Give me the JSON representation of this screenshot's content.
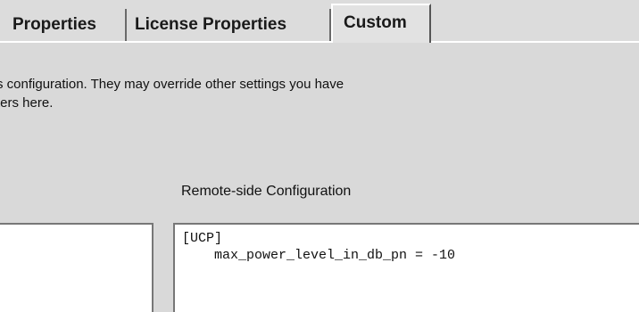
{
  "tabs": [
    {
      "label": "Properties",
      "active": false
    },
    {
      "label": "License Properties",
      "active": false
    },
    {
      "label": "Custom",
      "active": true
    }
  ],
  "description": {
    "line1": "s configuration. They may override other settings you have",
    "line2": "ters here."
  },
  "remote_config": {
    "label": "Remote-side Configuration",
    "line1": "[UCP]",
    "line2": "    max_power_level_in_db_pn = -10"
  },
  "local_config": {
    "value": ""
  }
}
